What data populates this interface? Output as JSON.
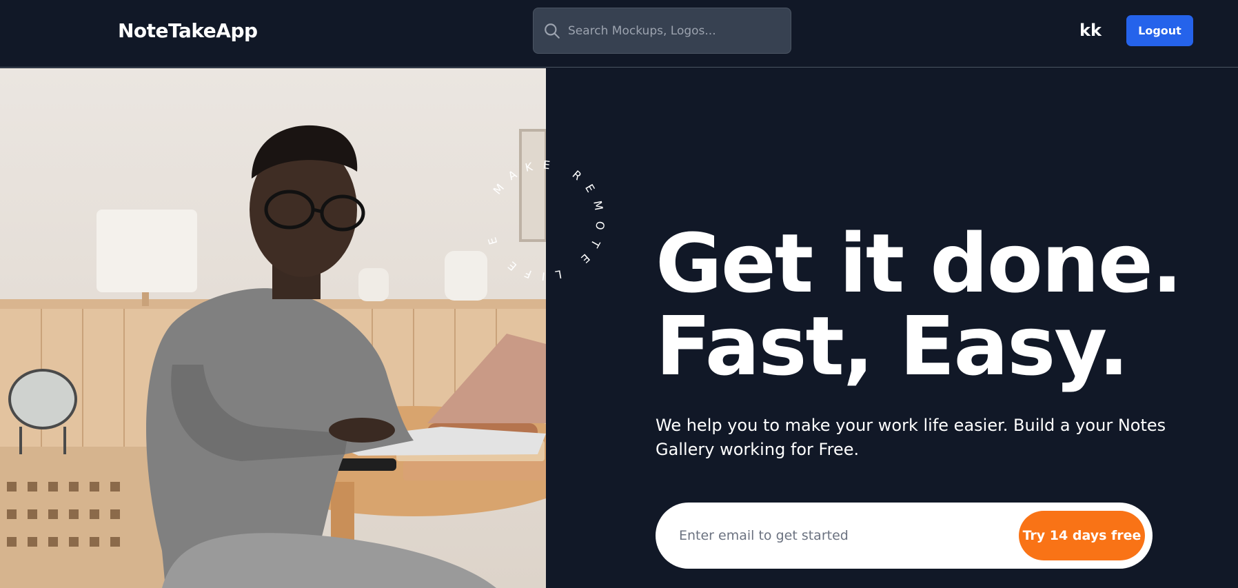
{
  "header": {
    "brand": "NoteTakeApp",
    "search_placeholder": "Search Mockups, Logos...",
    "user_initials": "kk",
    "logout_label": "Logout"
  },
  "hero": {
    "badge_text": "MAKE REMOTE LIFE EASY",
    "headline_line1": "Get it done.",
    "headline_line2": "Fast, Easy.",
    "description": "We help you to make your work life easier. Build a your Notes Gallery working for Free.",
    "email_placeholder": "Enter email to get started",
    "cta_label": "Try 14 days free"
  },
  "colors": {
    "background": "#111827",
    "primary_button": "#2563eb",
    "cta_button": "#f97316"
  },
  "icons": {
    "search": "search-icon"
  }
}
